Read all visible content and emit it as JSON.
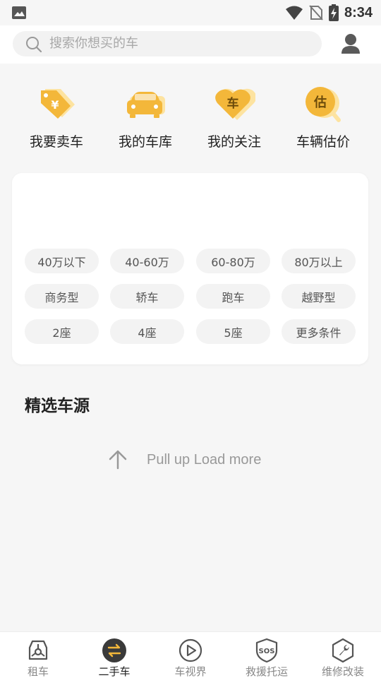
{
  "status_bar": {
    "time": "8:34"
  },
  "search": {
    "placeholder": "搜索你想买的车"
  },
  "shortcuts": [
    {
      "label": "我要卖车",
      "icon": "sell-tag-icon"
    },
    {
      "label": "我的车库",
      "icon": "garage-car-icon"
    },
    {
      "label": "我的关注",
      "icon": "heart-car-icon",
      "glyph": "车"
    },
    {
      "label": "车辆估价",
      "icon": "appraise-icon",
      "glyph": "估"
    }
  ],
  "filters": {
    "price": [
      "40万以下",
      "40-60万",
      "60-80万",
      "80万以上"
    ],
    "type": [
      "商务型",
      "轿车",
      "跑车",
      "越野型"
    ],
    "seats": [
      "2座",
      "4座",
      "5座",
      "更多条件"
    ]
  },
  "section": {
    "title": "精选车源"
  },
  "pull_up": {
    "text": "Pull up Load more"
  },
  "bottom_nav": [
    {
      "label": "租车",
      "icon": "rent-car-icon",
      "active": false
    },
    {
      "label": "二手车",
      "icon": "swap-icon",
      "active": true
    },
    {
      "label": "车视界",
      "icon": "play-icon",
      "active": false
    },
    {
      "label": "救援托运",
      "icon": "sos-shield-icon",
      "active": false
    },
    {
      "label": "维修改装",
      "icon": "wrench-icon",
      "active": false
    }
  ],
  "colors": {
    "accent": "#f3b73a",
    "accent_light": "#fde3a0",
    "active_nav": "#3a3a3a",
    "chip_bg": "#f3f3f3"
  }
}
